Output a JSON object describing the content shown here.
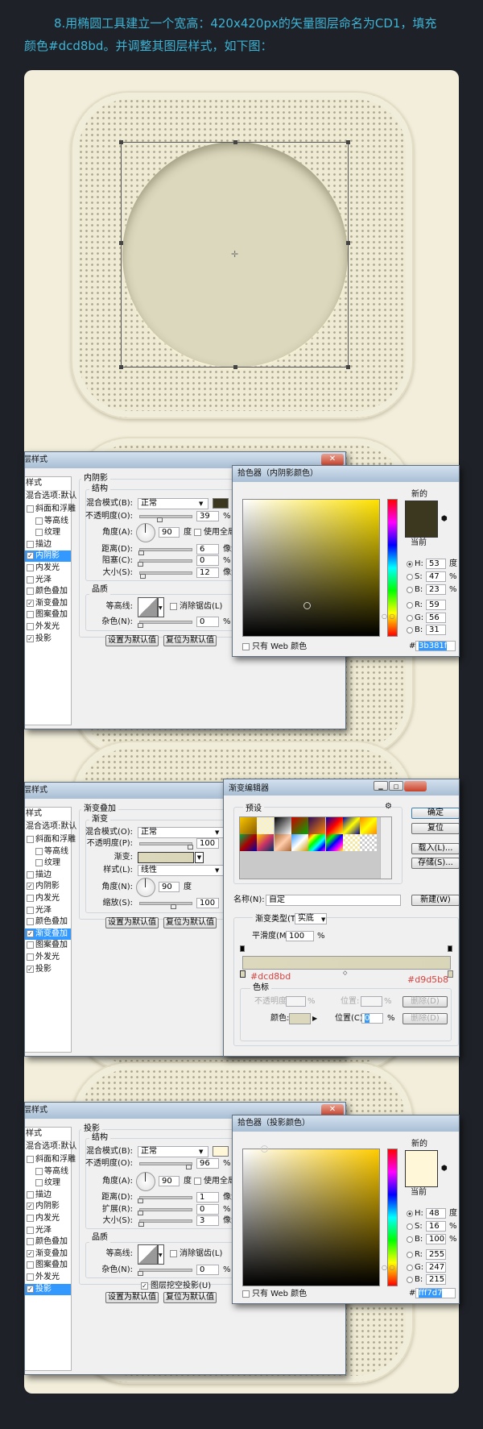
{
  "heading": {
    "line1": "8.用椭圆工具建立一个宽高：420x420px的矢量图层命名为CD1，填充",
    "line2": "颜色#dcd8bd。并调整其图层样式，如下图："
  },
  "colors": {
    "background": "#1e2127",
    "canvas": "#f2eedb",
    "heading": "#3eb4d6",
    "circle_fill": "#dcd8bd",
    "selection": "#3399ff",
    "annotation": "#d9413f"
  },
  "style_list": [
    "斜面和浮雕",
    "等高线",
    "纹理",
    "描边",
    "内阴影",
    "内发光",
    "光泽",
    "颜色叠加",
    "渐变叠加",
    "图案叠加",
    "外发光",
    "投影"
  ],
  "sections": [
    {
      "layer_style": {
        "title": "图层样式",
        "close": "✕",
        "styles_header": "样式",
        "blend_default": "混合选项:默认",
        "checked": [
          false,
          false,
          false,
          false,
          true,
          false,
          false,
          false,
          true,
          false,
          false,
          true
        ],
        "active": 4,
        "panel_title": "内阴影",
        "group_title": "结构",
        "rows": [
          {
            "kind": "select",
            "label": "混合模式(B):",
            "value": "正常",
            "swatch": "#3b381f"
          },
          {
            "kind": "slider",
            "label": "不透明度(O):",
            "value": "39",
            "unit": "%",
            "max": 100
          },
          {
            "kind": "angle",
            "label": "角度(A):",
            "value": "90",
            "unit": "度",
            "check": "使用全局光(G)",
            "checked": false
          },
          {
            "kind": "slider",
            "label": "距离(D):",
            "value": "6",
            "unit": "像素",
            "max": 250
          },
          {
            "kind": "slider",
            "label": "阻塞(C):",
            "value": "0",
            "unit": "%",
            "max": 100
          },
          {
            "kind": "slider",
            "label": "大小(S):",
            "value": "12",
            "unit": "像素",
            "max": 250
          }
        ],
        "quality": {
          "title": "品质",
          "contour_label": "等高线:",
          "antialias": "消除锯齿(L)",
          "noise_label": "杂色(N):",
          "noise": "0",
          "unit": "%"
        },
        "make_default": "设置为默认值",
        "reset_default": "复位为默认值"
      },
      "picker": {
        "title": "拾色器（内阴影颜色）",
        "new_label": "新的",
        "current_label": "当前",
        "color": "#3b381f",
        "hsb": [
          {
            "label": "H:",
            "value": "53",
            "unit": "度",
            "selected": true
          },
          {
            "label": "S:",
            "value": "47",
            "unit": "%"
          },
          {
            "label": "B:",
            "value": "23",
            "unit": "%"
          }
        ],
        "rgb": [
          {
            "label": "R:",
            "value": "59"
          },
          {
            "label": "G:",
            "value": "56"
          },
          {
            "label": "B:",
            "value": "31"
          }
        ],
        "web_only": "只有 Web 颜色",
        "hash": "#",
        "hex": "3b381f"
      }
    },
    {
      "layer_style": {
        "title": "图层样式",
        "styles_header": "样式",
        "blend_default": "混合选项:默认",
        "checked": [
          false,
          false,
          false,
          false,
          true,
          false,
          false,
          false,
          true,
          false,
          false,
          true
        ],
        "active": 8,
        "panel_title": "渐变叠加",
        "group_title": "渐变",
        "rows": [
          {
            "kind": "select",
            "label": "混合模式(O):",
            "value": "正常",
            "check": "仿色",
            "checked": false
          },
          {
            "kind": "slider",
            "label": "不透明度(P):",
            "value": "100",
            "unit": "",
            "max": 100
          },
          {
            "kind": "gradient",
            "label": "渐变:",
            "colors": [
              "#dcd8bd",
              "#d9d5b8"
            ],
            "check": "反向",
            "checked": false
          },
          {
            "kind": "select",
            "label": "样式(L):",
            "value": "线性",
            "check": "与图层对齐",
            "checked": true
          },
          {
            "kind": "angle",
            "label": "角度(N):",
            "value": "90",
            "unit": "度"
          },
          {
            "kind": "slider",
            "label": "缩放(S):",
            "value": "100",
            "unit": "",
            "max": 150
          }
        ],
        "make_default": "设置为默认值",
        "reset_default": "复位为默认值"
      },
      "gradient_editor": {
        "title": "渐变编辑器",
        "presets_label": "预设",
        "ok": "确定",
        "reset": "复位",
        "load": "载入(L)...",
        "save": "存储(S)...",
        "name_label": "名称(N):",
        "name_value": "自定",
        "new": "新建(W)",
        "type_label": "渐变类型(T):",
        "type_value": "实底",
        "smooth_label": "平滑度(M):",
        "smooth_value": "100",
        "pct": "%",
        "start_color": "#dcd8bd",
        "end_color": "#d9d5b8",
        "stops_label": "色标",
        "opacity_label": "不透明度:",
        "location_label": "位置:",
        "delete": "删除(D)",
        "color_label": "颜色:",
        "location_c_label": "位置(C):",
        "location_value": "0"
      }
    },
    {
      "layer_style": {
        "title": "图层样式",
        "close": "✕",
        "styles_header": "样式",
        "blend_default": "混合选项:默认",
        "checked": [
          false,
          false,
          false,
          false,
          true,
          false,
          false,
          false,
          true,
          false,
          false,
          true
        ],
        "active": 11,
        "panel_title": "投影",
        "group_title": "结构",
        "rows": [
          {
            "kind": "select",
            "label": "混合模式(B):",
            "value": "正常",
            "swatch": "#fff7d7"
          },
          {
            "kind": "slider",
            "label": "不透明度(O):",
            "value": "96",
            "unit": "%",
            "max": 100
          },
          {
            "kind": "angle",
            "label": "角度(A):",
            "value": "90",
            "unit": "度",
            "check": "使用全局光(G)",
            "checked": false
          },
          {
            "kind": "slider",
            "label": "距离(D):",
            "value": "1",
            "unit": "像素",
            "max": 250
          },
          {
            "kind": "slider",
            "label": "扩展(R):",
            "value": "0",
            "unit": "%",
            "max": 100
          },
          {
            "kind": "slider",
            "label": "大小(S):",
            "value": "3",
            "unit": "像素",
            "max": 250
          }
        ],
        "quality": {
          "title": "品质",
          "contour_label": "等高线:",
          "antialias": "消除锯齿(L)",
          "noise_label": "杂色(N):",
          "noise": "0",
          "unit": "%",
          "knockout": "图层挖空投影(U)",
          "knockout_checked": true
        },
        "make_default": "设置为默认值",
        "reset_default": "复位为默认值"
      },
      "picker": {
        "title": "拾色器（投影颜色）",
        "new_label": "新的",
        "current_label": "当前",
        "color": "#fff7d7",
        "hsb": [
          {
            "label": "H:",
            "value": "48",
            "unit": "度",
            "selected": true
          },
          {
            "label": "S:",
            "value": "16",
            "unit": "%"
          },
          {
            "label": "B:",
            "value": "100",
            "unit": "%"
          }
        ],
        "rgb": [
          {
            "label": "R:",
            "value": "255"
          },
          {
            "label": "G:",
            "value": "247"
          },
          {
            "label": "B:",
            "value": "215"
          }
        ],
        "web_only": "只有 Web 颜色",
        "hash": "#",
        "hex": "fff7d7"
      }
    }
  ]
}
